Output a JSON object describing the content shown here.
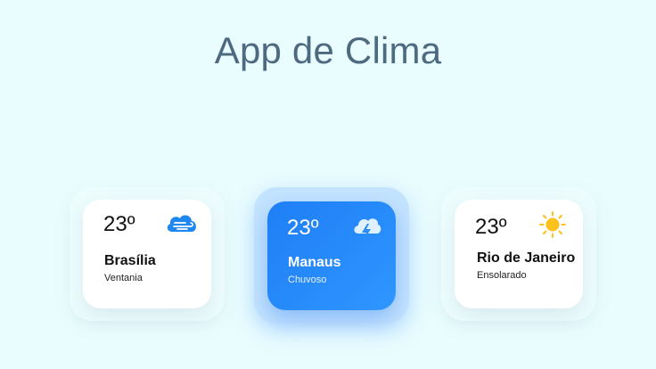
{
  "header": {
    "title": "App de Clima"
  },
  "cards": [
    {
      "temperature": "23º",
      "city": "Brasília",
      "condition": "Ventania",
      "icon": "windy-cloud-icon"
    },
    {
      "temperature": "23º",
      "city": "Manaus",
      "condition": "Chuvoso",
      "icon": "storm-cloud-icon"
    },
    {
      "temperature": "23º",
      "city": "Rio de Janeiro",
      "condition": "Ensolarado",
      "icon": "sun-icon"
    }
  ],
  "colors": {
    "background": "#e9fdfe",
    "title": "#4d6a80",
    "accent_blue": "#1f7ef5",
    "sun": "#fbc21c"
  }
}
